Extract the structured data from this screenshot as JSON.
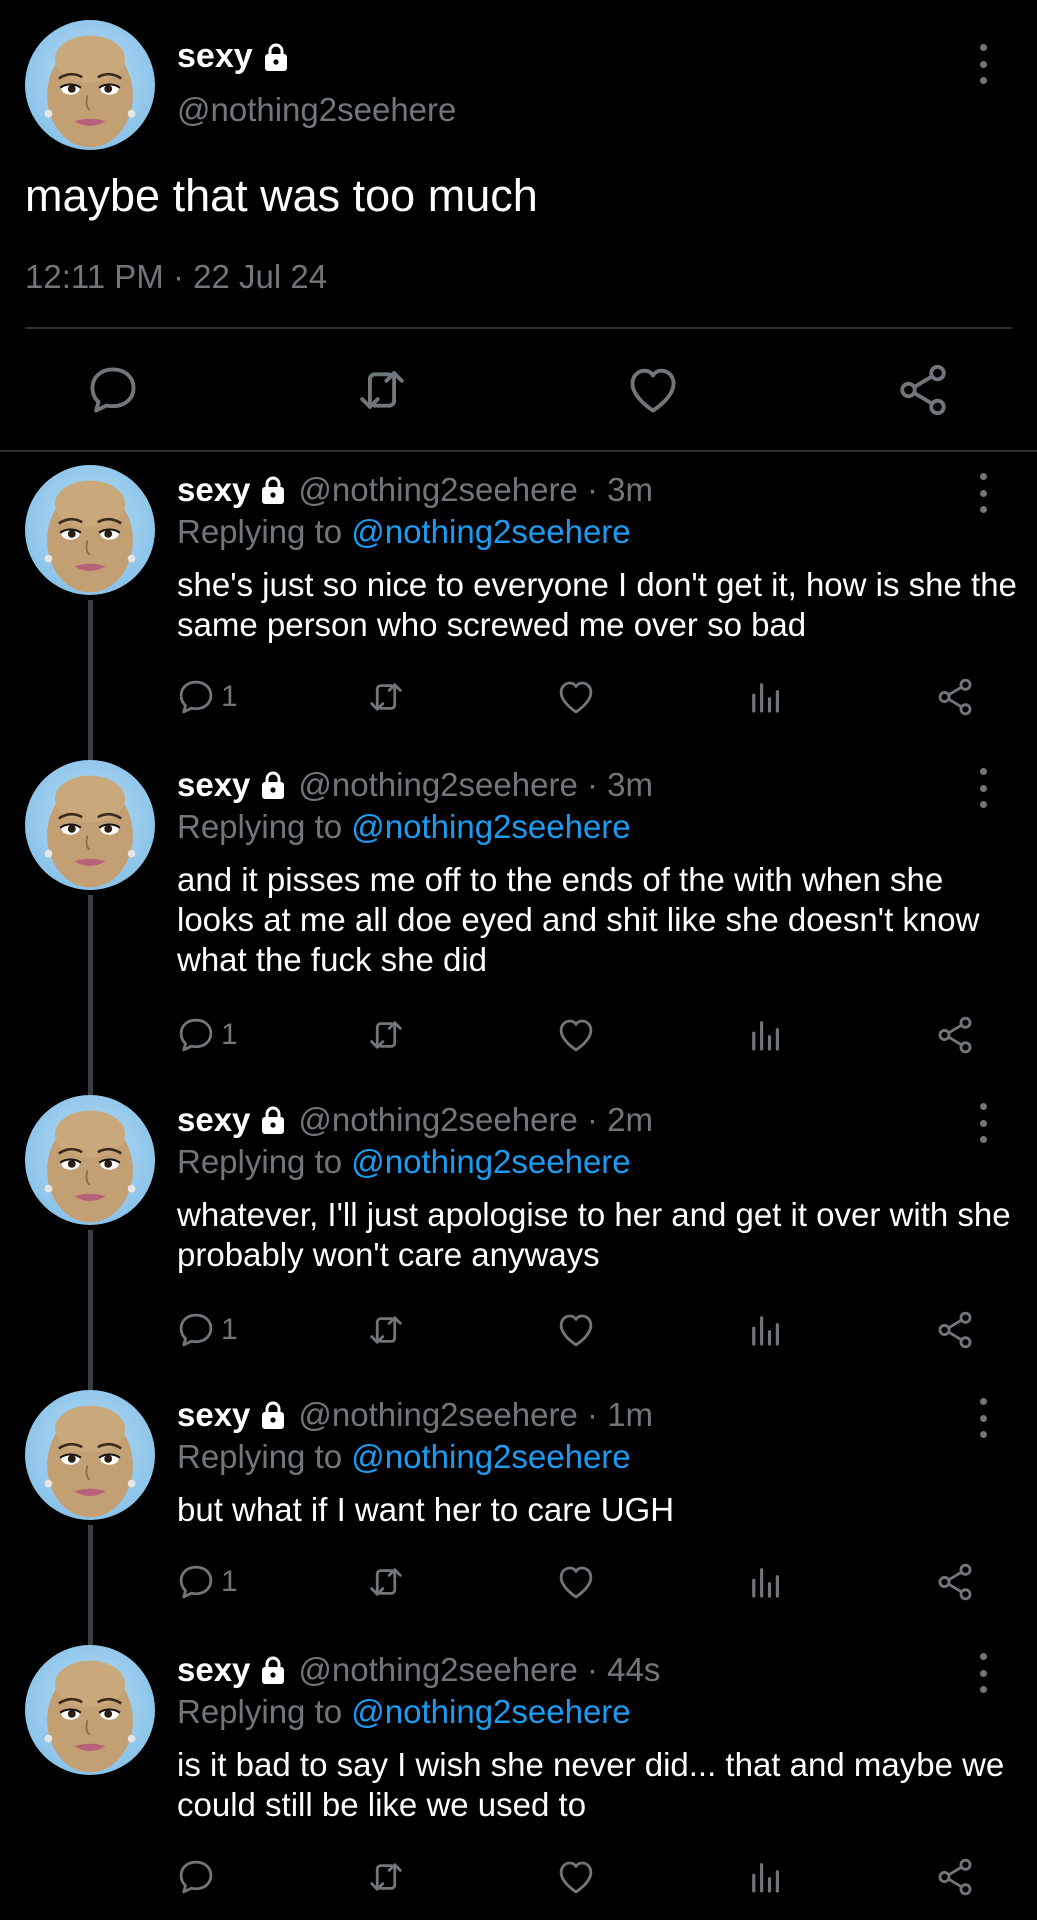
{
  "main_tweet": {
    "display_name": "sexy",
    "handle": "@nothing2seehere",
    "text": "maybe that was too much",
    "timestamp": "12:11 PM · 22 Jul 24",
    "icons": [
      "reply-icon",
      "retweet-icon",
      "like-icon",
      "share-icon",
      "lock-icon",
      "more-icon"
    ]
  },
  "replies": [
    {
      "display_name": "sexy",
      "meta": "@nothing2seehere · 3m",
      "replying_prefix": "Replying to",
      "replying_to": "@nothing2seehere",
      "text": "she's just so nice to everyone I don't get it, how is she the same person who screwed me over so bad",
      "reply_count": "1"
    },
    {
      "display_name": "sexy",
      "meta": "@nothing2seehere · 3m",
      "replying_prefix": "Replying to",
      "replying_to": "@nothing2seehere",
      "text": "and it pisses me off to the ends of the with when she looks at me all doe eyed and shit like she doesn't know what the fuck she did",
      "reply_count": "1"
    },
    {
      "display_name": "sexy",
      "meta": "@nothing2seehere · 2m",
      "replying_prefix": "Replying to",
      "replying_to": "@nothing2seehere",
      "text": "whatever, I'll just apologise to her and get it over with she probably won't care anyways",
      "reply_count": "1"
    },
    {
      "display_name": "sexy",
      "meta": "@nothing2seehere · 1m",
      "replying_prefix": "Replying to",
      "replying_to": "@nothing2seehere",
      "text": "but what if I want her to care UGH",
      "reply_count": "1"
    },
    {
      "display_name": "sexy",
      "meta": "@nothing2seehere · 44s",
      "replying_prefix": "Replying to",
      "replying_to": "@nothing2seehere",
      "text": "is it bad to say I wish she never did... that and maybe we could still be like we used to",
      "reply_count": ""
    }
  ],
  "colors": {
    "background": "#000000",
    "text": "#ffffff",
    "muted": "#71767b",
    "mention": "#1d9bf0",
    "divider": "#2f3336"
  }
}
